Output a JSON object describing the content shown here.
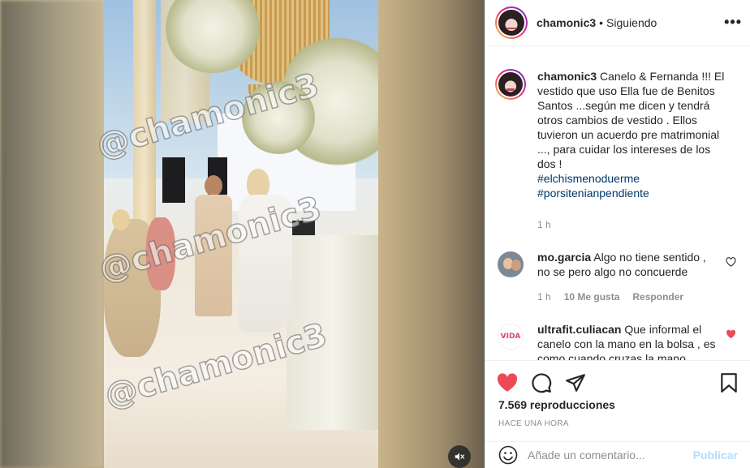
{
  "video": {
    "watermark": "@chamonic3"
  },
  "header": {
    "username": "chamonic3",
    "separator": "•",
    "follow_status": "Siguiendo",
    "more": "•••"
  },
  "caption": {
    "username": "chamonic3",
    "text": "Canelo & Fernanda !!! El vestido que uso Ella fue de Benitos Santos ...según me dicen y tendrá otros cambios de vestido . Ellos tuvieron un acuerdo pre matrimonial ..., para cuidar los intereses de los dos !",
    "hashtags": [
      "#elchismenoduerme",
      "#porsitenianpendiente"
    ],
    "time": "1 h"
  },
  "comments": [
    {
      "username": "mo.garcia",
      "text": "Algo no tiene sentido , no se pero algo no concuerde",
      "time": "1 h",
      "likes": "10 Me gusta",
      "reply": "Responder",
      "liked": false
    },
    {
      "username": "ultrafit.culiacan",
      "text": "Que informal el canelo con la mano en la bolsa , es como cuando cruzas la mano",
      "avatar_label": "VIDA",
      "liked": true
    }
  ],
  "stats": {
    "views": "7.569 reproducciones",
    "posted": "HACE UNA HORA"
  },
  "add_comment": {
    "placeholder": "Añade un comentario...",
    "post_label": "Publicar"
  },
  "colors": {
    "like_red": "#ed4956",
    "link_blue": "#00376b",
    "post_disabled": "#b2dffc"
  }
}
